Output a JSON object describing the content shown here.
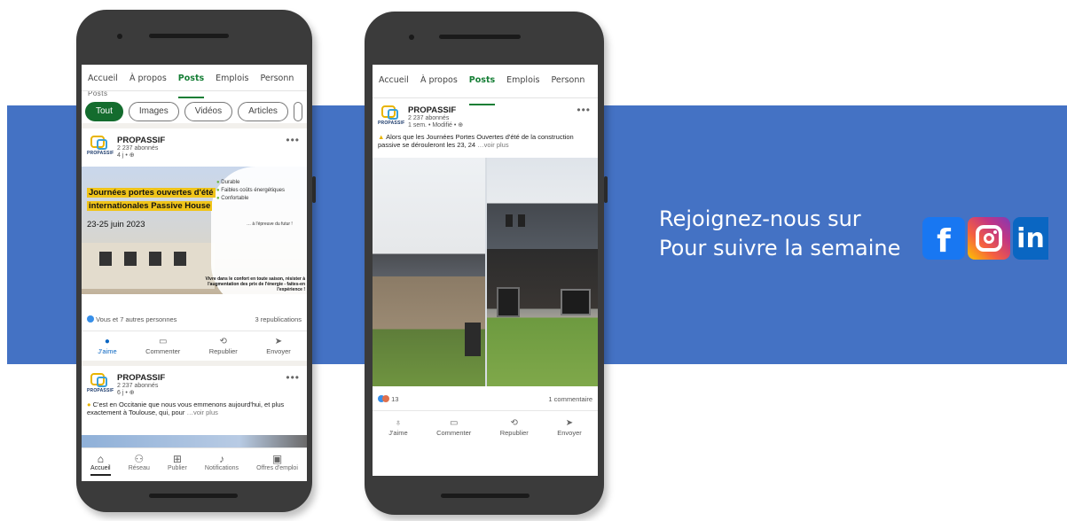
{
  "promo": {
    "line1": "Rejoignez-nous sur",
    "line2": "Pour suivre la semaine",
    "icons": [
      "facebook-icon",
      "instagram-icon",
      "linkedin-icon"
    ],
    "band_color": "#4472c4"
  },
  "phone1": {
    "tabs": [
      "Accueil",
      "À propos",
      "Posts",
      "Emplois",
      "Personn"
    ],
    "active_tab": "Posts",
    "ghost_label": "Posts",
    "filters": [
      "Tout",
      "Images",
      "Vidéos",
      "Articles"
    ],
    "post1": {
      "author": "PROPASSIF",
      "followers": "2 237 abonnés",
      "age": "4 j • ⊕",
      "logo_text": "PROPASSIF",
      "banner": {
        "title_line1": "Journées portes ouvertes d'été",
        "title_line2": "internationales Passive House",
        "date": "23-25 juin 2023",
        "features": [
          "Durable",
          "Faibles coûts énergétiques",
          "Confortable"
        ],
        "feature_foot": "… à l'épreuve du futur !",
        "subtitle": "Vivre dans le confort en toute saison, résister à l'augmentation des prix de l'énergie - faites-en l'expérience !"
      },
      "reactions": "Vous et 7 autres personnes",
      "reposts": "3 republications",
      "actions": [
        "J'aime",
        "Commenter",
        "Republier",
        "Envoyer"
      ]
    },
    "post2": {
      "author": "PROPASSIF",
      "followers": "2 237 abonnés",
      "age": "6 j • ⊕",
      "text": "C'est en Occitanie que nous vous emmenons aujourd'hui, et plus exactement à Toulouse, qui, pour",
      "more": "…voir plus"
    },
    "bottom_nav": [
      "Accueil",
      "Réseau",
      "Publier",
      "Notifications",
      "Offres d'emploi"
    ]
  },
  "phone2": {
    "tabs": [
      "Accueil",
      "À propos",
      "Posts",
      "Emplois",
      "Personn"
    ],
    "active_tab": "Posts",
    "post": {
      "author": "PROPASSIF",
      "followers": "2 237 abonnés",
      "age": "1 sem. • Modifié • ⊕",
      "text": "Alors que les Journées Portes Ouvertes d'été de la construction passive se dérouleront les 23, 24",
      "more": "…voir plus",
      "reaction_count": "13",
      "comments": "1 commentaire",
      "actions": [
        "J'aime",
        "Commenter",
        "Republier",
        "Envoyer"
      ]
    }
  }
}
